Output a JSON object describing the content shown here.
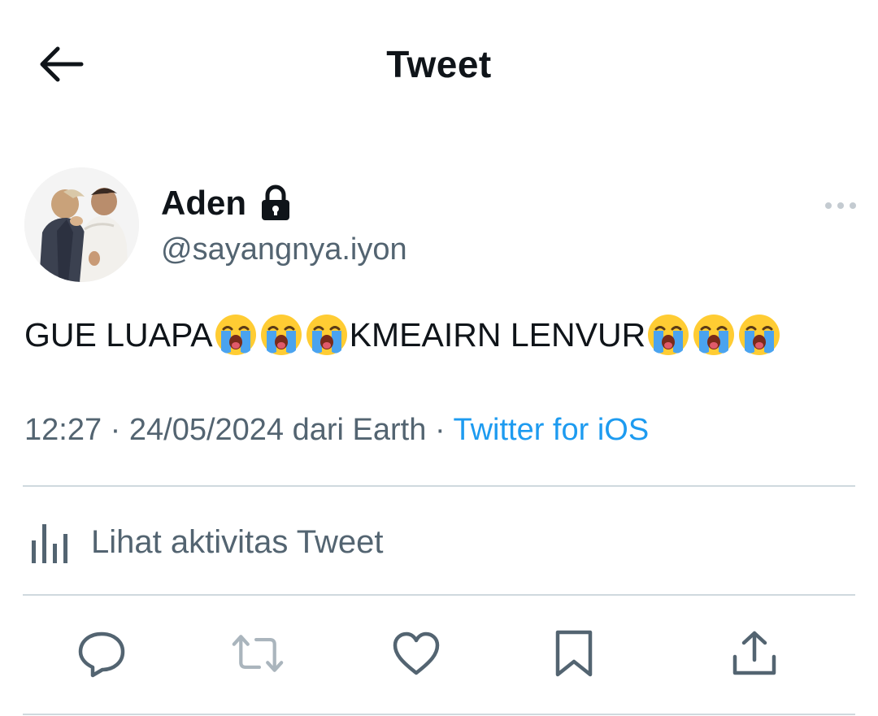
{
  "header": {
    "title": "Tweet",
    "back_icon": "arrow-left-icon"
  },
  "author": {
    "display_name": "Aden",
    "handle": "@sayangnya.iyon",
    "protected_icon": "lock-icon",
    "avatar_icon": "avatar-photo"
  },
  "tweet": {
    "segments": [
      {
        "type": "text",
        "value": "GUE LUAPA"
      },
      {
        "type": "emoji",
        "name": "loudly-crying-face-icon"
      },
      {
        "type": "emoji",
        "name": "loudly-crying-face-icon"
      },
      {
        "type": "emoji",
        "name": "loudly-crying-face-icon"
      },
      {
        "type": "text",
        "value": "KMEAIRN LENVUR"
      },
      {
        "type": "emoji",
        "name": "loudly-crying-face-icon"
      },
      {
        "type": "emoji",
        "name": "loudly-crying-face-icon"
      },
      {
        "type": "emoji",
        "name": "loudly-crying-face-icon"
      }
    ],
    "text_part_1": "GUE LUAPA",
    "text_part_2": "KMEAIRN LENVUR"
  },
  "meta": {
    "time": "12:27",
    "separator": "·",
    "date": "24/05/2024",
    "location_text": "dari Earth",
    "source": "Twitter for iOS"
  },
  "activity": {
    "label": "Lihat aktivitas Tweet",
    "icon": "bar-chart-icon"
  },
  "actions": [
    {
      "name": "reply-button",
      "icon": "reply-icon"
    },
    {
      "name": "retweet-button",
      "icon": "retweet-icon"
    },
    {
      "name": "like-button",
      "icon": "heart-icon"
    },
    {
      "name": "bookmark-button",
      "icon": "bookmark-icon"
    },
    {
      "name": "share-button",
      "icon": "share-icon"
    }
  ],
  "colors": {
    "text_primary": "#0f1419",
    "text_secondary": "#536471",
    "accent": "#1d9bf0",
    "divider": "#cfd9de",
    "emoji_face": "#ffcc33",
    "emoji_tears": "#4aa3ef"
  }
}
